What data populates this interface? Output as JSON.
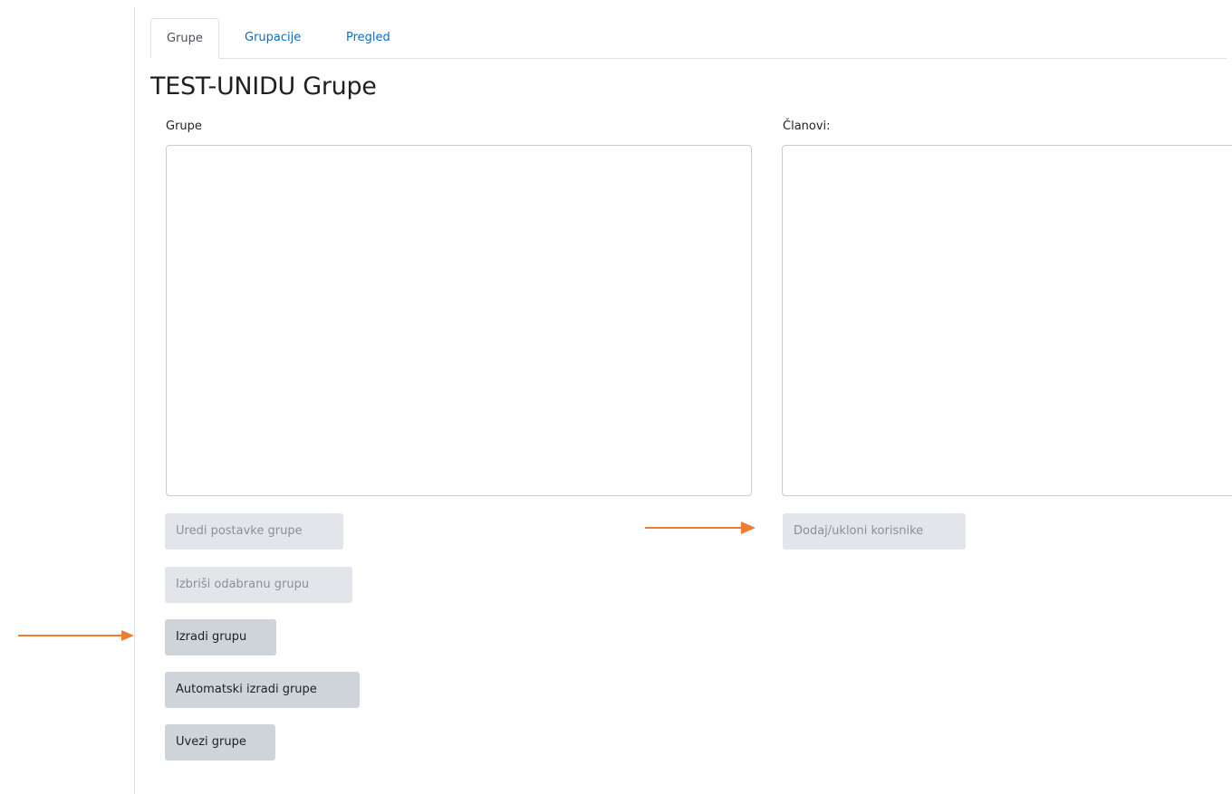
{
  "tabs": [
    {
      "label": "Grupe",
      "active": true
    },
    {
      "label": "Grupacije",
      "active": false
    },
    {
      "label": "Pregled",
      "active": false
    }
  ],
  "page_title": "TEST-UNIDU Grupe",
  "groups_panel": {
    "label": "Grupe",
    "buttons": {
      "edit": "Uredi postavke grupe",
      "delete": "Izbriši odabranu grupu",
      "create": "Izradi grupu",
      "auto_create": "Automatski izradi grupe",
      "import": "Uvezi grupe"
    }
  },
  "members_panel": {
    "label": "Članovi:",
    "buttons": {
      "add_remove": "Dodaj/ukloni korisnike"
    }
  },
  "colors": {
    "accent_arrow": "#ed7d31",
    "tab_link": "#0f6cbf"
  },
  "annotations": [
    "orange-arrow-left",
    "orange-arrow-right"
  ]
}
